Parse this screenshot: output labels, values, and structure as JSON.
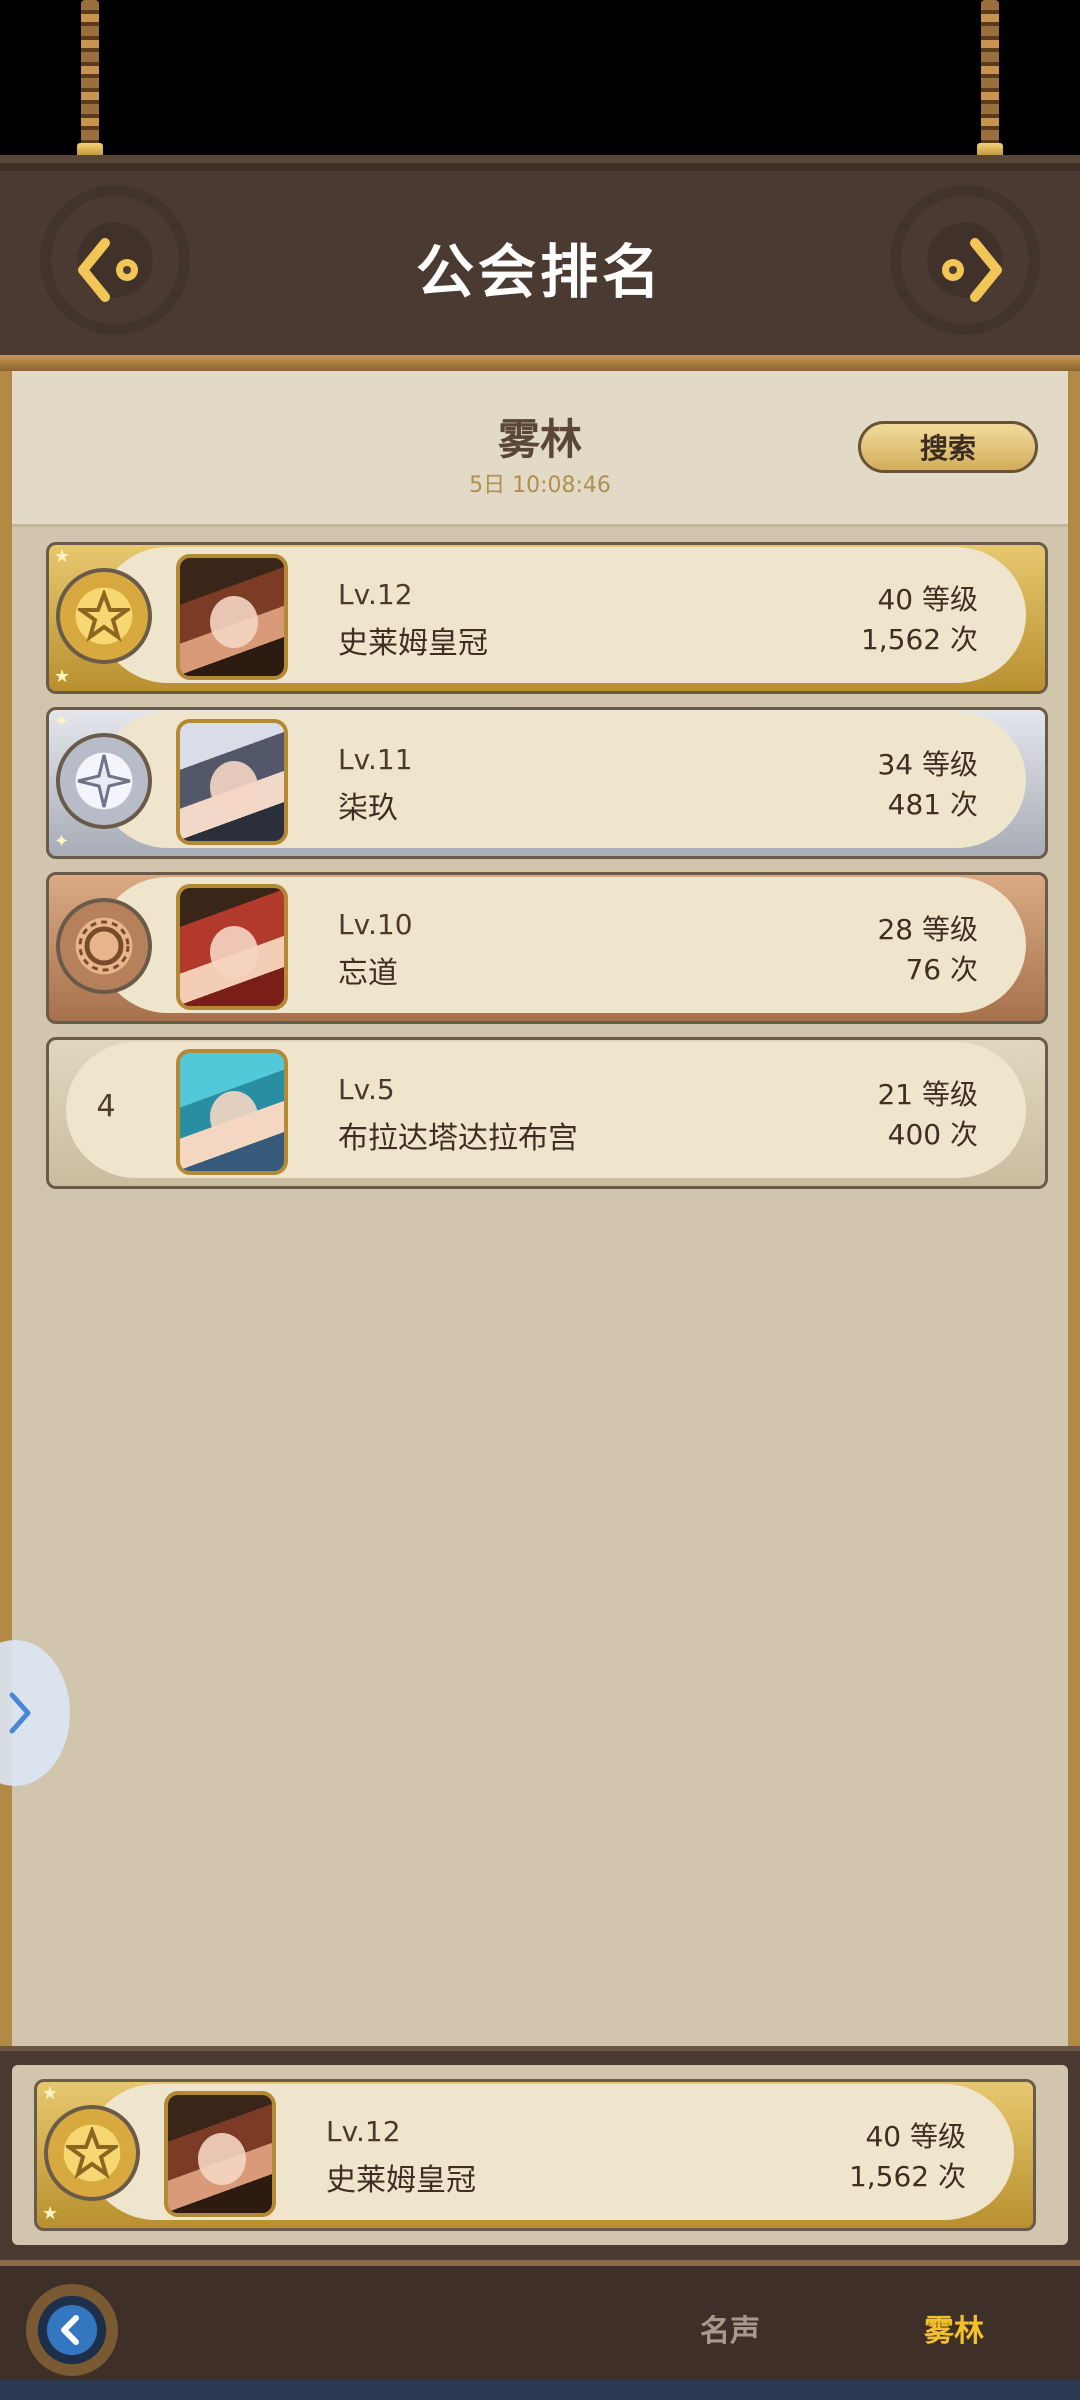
{
  "header": {
    "title": "公会排名"
  },
  "panel": {
    "guild_name": "雾林",
    "time": "5日 10:08:46",
    "search_label": "搜索"
  },
  "rankings": [
    {
      "rank_type": "gold",
      "level": "Lv.12",
      "name": "史莱姆皇冠",
      "grade": "40 等级",
      "count": "1,562 次"
    },
    {
      "rank_type": "silver",
      "level": "Lv.11",
      "name": "柒玖",
      "grade": "34 等级",
      "count": "481 次"
    },
    {
      "rank_type": "bronze",
      "level": "Lv.10",
      "name": "忘道",
      "grade": "28 等级",
      "count": "76 次"
    },
    {
      "rank": "4",
      "level": "Lv.5",
      "name": "布拉达塔达拉布宫",
      "grade": "21 等级",
      "count": "400 次"
    }
  ],
  "my_rank": {
    "rank_type": "gold",
    "level": "Lv.12",
    "name": "史莱姆皇冠",
    "grade": "40 等级",
    "count": "1,562 次"
  },
  "tabs": {
    "fame": "名声",
    "mist": "雾林"
  },
  "colors": {
    "gold": "#d7a93e",
    "silver": "#b7bcc8",
    "bronze": "#b5805a",
    "active_tab": "#f1c02a"
  }
}
